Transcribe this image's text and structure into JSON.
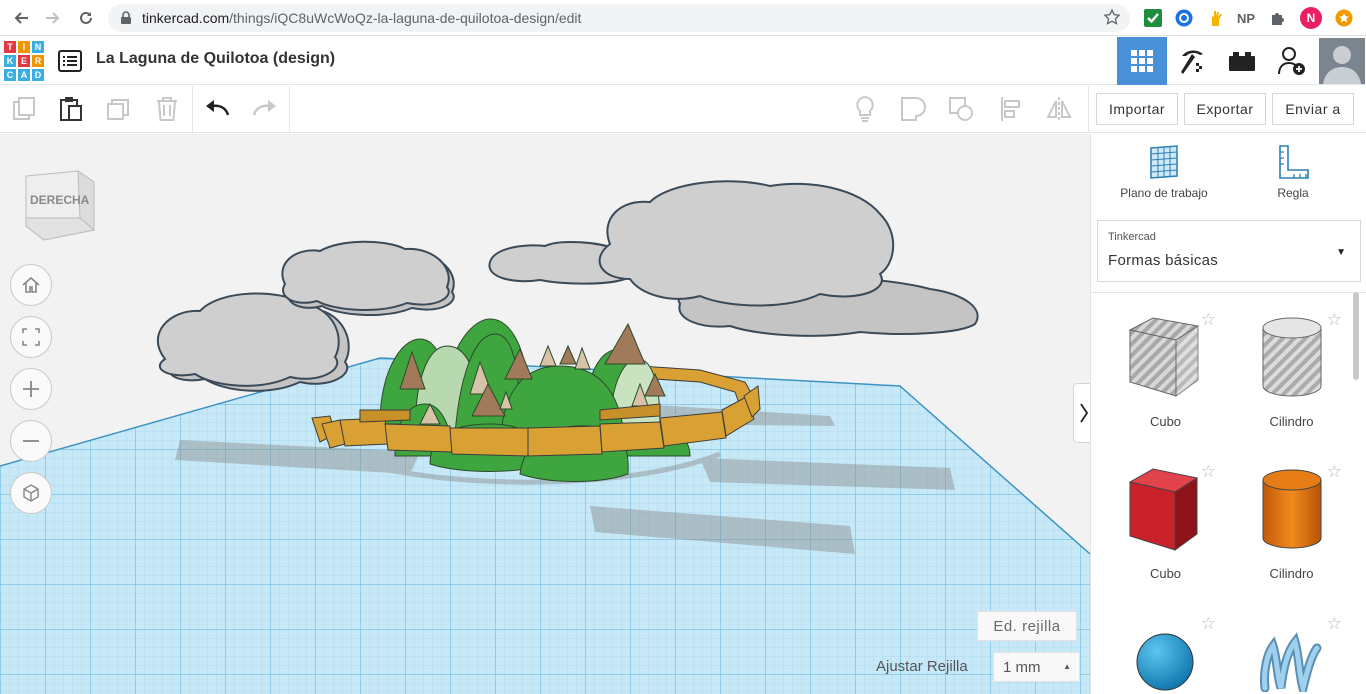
{
  "browser": {
    "url_host": "tinkercad.com",
    "url_path": "/things/iQC8uWcWoQz-la-laguna-de-quilotoa-design/edit",
    "extensions": [
      "check-extension-icon",
      "globe-extension-icon",
      "hand-extension-icon",
      "NP",
      "puzzle-icon",
      "N",
      "notification-icon"
    ],
    "np_label": "NP",
    "profile_initial": "N"
  },
  "app": {
    "logo_letters": [
      "TIN",
      "KER",
      "CAD"
    ],
    "design_title": "La Laguna de Quilotoa (design)"
  },
  "toolbar": {
    "import_label": "Importar",
    "export_label": "Exportar",
    "send_label": "Enviar a"
  },
  "viewport": {
    "viewcube_label": "DERECHA",
    "grid_edit_label": "Ed. rejilla",
    "snap_label": "Ajustar Rejilla",
    "snap_value": "1 mm"
  },
  "side_panel": {
    "workplane_label": "Plano de trabajo",
    "ruler_label": "Regla",
    "library_source": "Tinkercad",
    "library_name": "Formas básicas",
    "shapes": [
      {
        "label": "Cubo",
        "style": "hole"
      },
      {
        "label": "Cilindro",
        "style": "hole"
      },
      {
        "label": "Cubo",
        "color": "#d7262c"
      },
      {
        "label": "Cilindro",
        "color": "#e9760f"
      }
    ]
  },
  "colors": {
    "accent": "#4a90d9",
    "grid_blue": "#7ec8e8",
    "cloud": "#c8c8c8",
    "mountain_green": "#3aa63a",
    "wall_gold": "#d4a030"
  }
}
